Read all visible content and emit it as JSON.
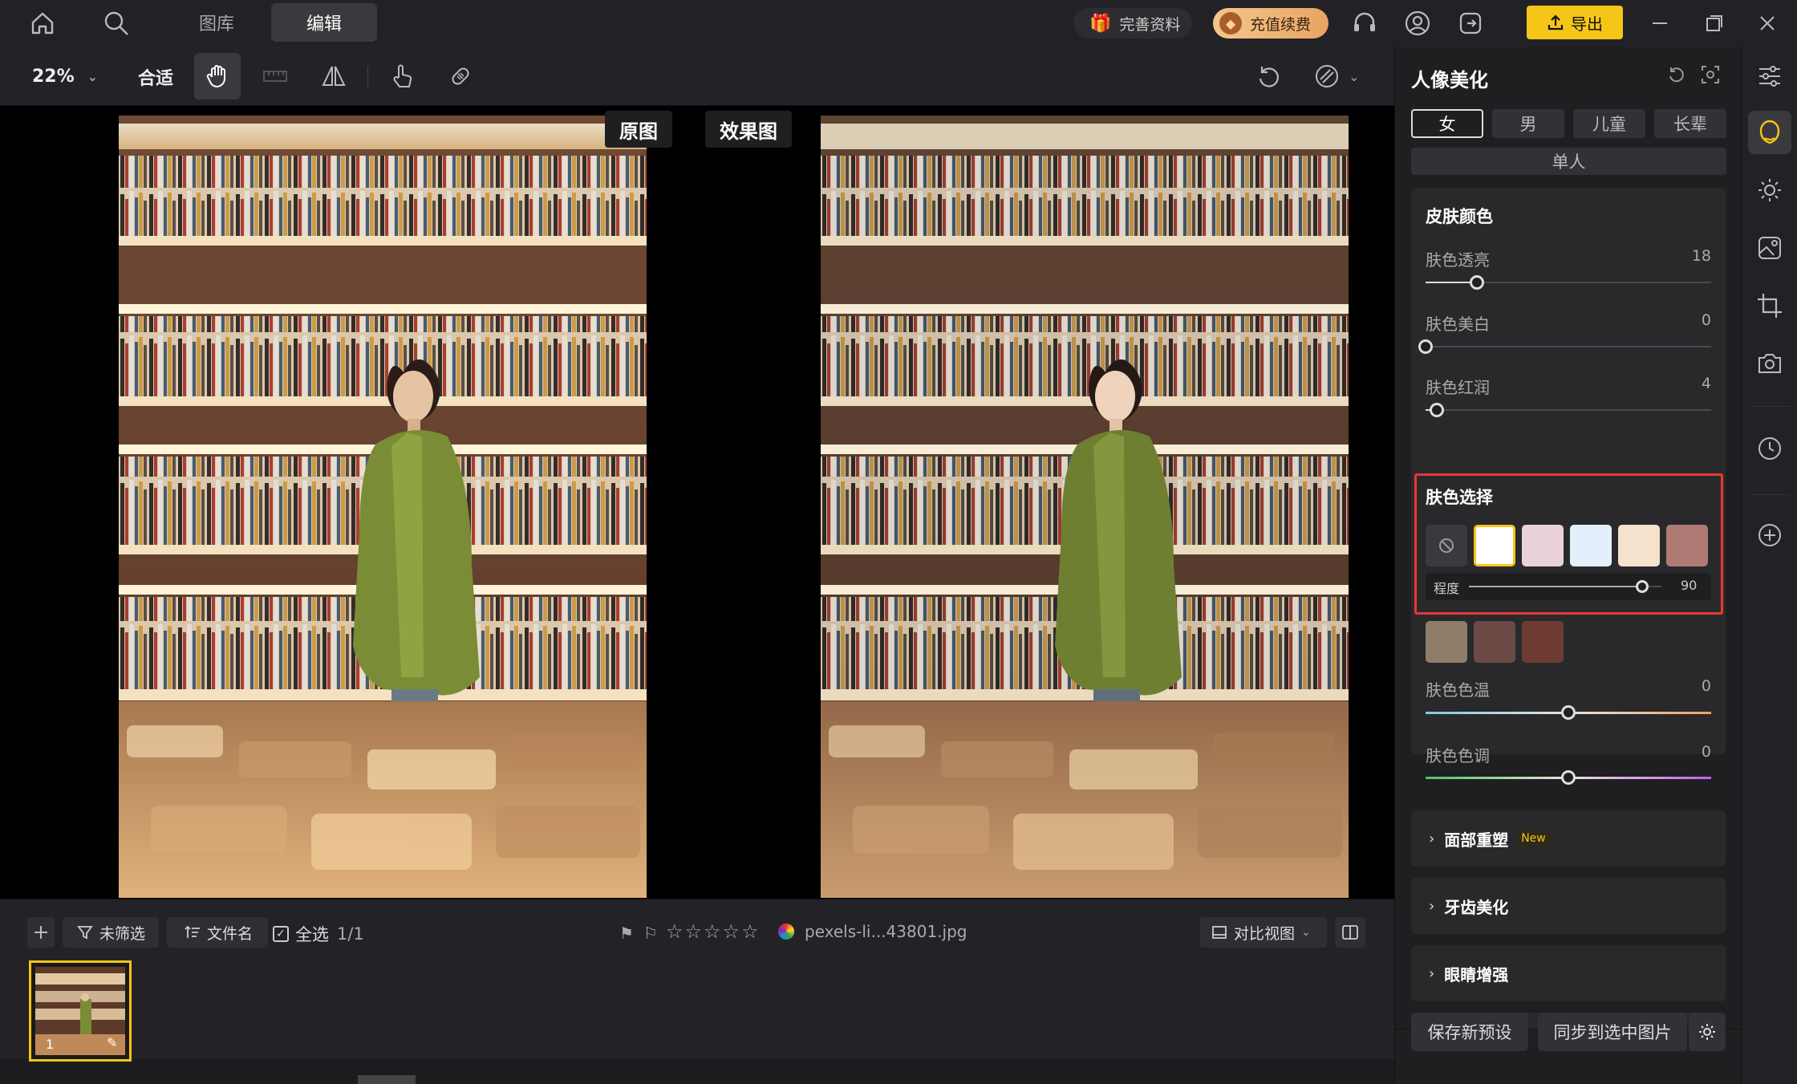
{
  "nav": {
    "tabs": [
      {
        "label": "图库"
      },
      {
        "label": "编辑"
      }
    ]
  },
  "header": {
    "profile_label": "完善资料",
    "vip_label": "充值续费",
    "export_label": "导出"
  },
  "toolbar": {
    "zoom": "22%",
    "fit_label": "合适"
  },
  "canvas": {
    "original_label": "原图",
    "effect_label": "效果图"
  },
  "filmstrip": {
    "filter_label": "未筛选",
    "sort_label": "文件名",
    "select_all_label": "全选",
    "count": "1/1",
    "filename": "pexels-li...43801.jpg",
    "view_mode": "对比视图",
    "thumb_index": "1",
    "rating_stars": 5
  },
  "panel": {
    "title": "人像美化",
    "gender_tabs": [
      {
        "label": "女"
      },
      {
        "label": "男"
      },
      {
        "label": "儿童"
      },
      {
        "label": "长辈"
      }
    ],
    "person_mode": "单人",
    "skin_color_title": "皮肤颜色",
    "sliders": [
      {
        "label": "肤色透亮",
        "value": "18",
        "level": 0.18
      },
      {
        "label": "肤色美白",
        "value": "0",
        "level": 0
      },
      {
        "label": "肤色红润",
        "value": "4",
        "level": 0.04
      }
    ],
    "skin_select_title": "肤色选择",
    "swatches_row1": [
      "#ffffff",
      "#ead3d8",
      "#e3f0fb",
      "#f4e2cc",
      "#b07a74"
    ],
    "swatches_row2": [
      "#8f7d6a",
      "#6b4a45",
      "#6e3b33"
    ],
    "degree_label": "程度",
    "degree_value": "90",
    "degree_level": 0.9,
    "temp_label": "肤色色温",
    "temp_value": "0",
    "tone_label": "肤色色调",
    "tone_value": "0",
    "sections": [
      {
        "label": "面部重塑"
      },
      {
        "label": "牙齿美化"
      },
      {
        "label": "眼睛增强"
      }
    ],
    "new_badge": "New",
    "save_preset": "保存新预设",
    "sync_label": "同步到选中图片"
  },
  "colors": {
    "accent": "#f5c518",
    "highlight": "#e53935"
  }
}
